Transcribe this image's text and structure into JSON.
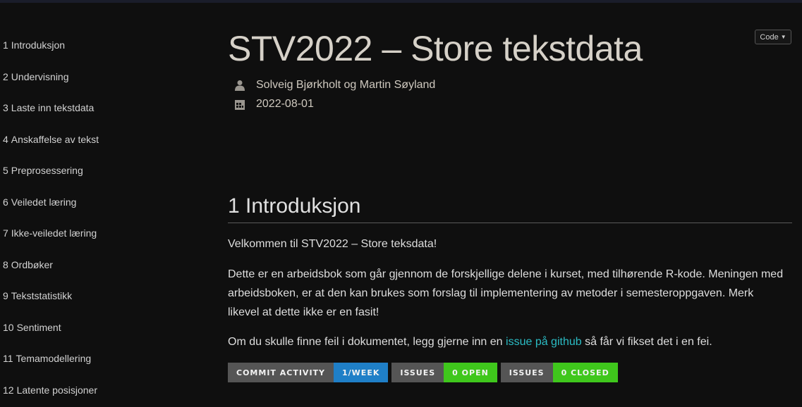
{
  "sidebar": {
    "items": [
      {
        "num": "1",
        "label": "Introduksjon"
      },
      {
        "num": "2",
        "label": "Undervisning"
      },
      {
        "num": "3",
        "label": "Laste inn tekstdata"
      },
      {
        "num": "4",
        "label": "Anskaffelse av tekst"
      },
      {
        "num": "5",
        "label": "Preprosessering"
      },
      {
        "num": "6",
        "label": "Veiledet læring"
      },
      {
        "num": "7",
        "label": "Ikke-veiledet læring"
      },
      {
        "num": "8",
        "label": "Ordbøker"
      },
      {
        "num": "9",
        "label": "Tekststatistikk"
      },
      {
        "num": "10",
        "label": "Sentiment"
      },
      {
        "num": "11",
        "label": "Temamodellering"
      },
      {
        "num": "12",
        "label": "Latente posisjoner"
      }
    ]
  },
  "header": {
    "title": "STV2022 – Store tekstdata",
    "author": "Solveig Bjørkholt og Martin Søyland",
    "date": "2022-08-01",
    "code_button": "Code"
  },
  "section": {
    "title": "1 Introduksjon",
    "p1": "Velkommen til STV2022 – Store teksdata!",
    "p2": "Dette er en arbeidsbok som går gjennom de forskjellige delene i kurset, med tilhørende R-kode. Meningen med arbeidsboken, er at den kan brukes som forslag til implementering av metoder i semesteroppgaven. Merk likevel at dette ikke er en fasit!",
    "p3_before": "Om du skulle finne feil i dokumentet, legg gjerne inn en",
    "p3_link": "issue på github",
    "p3_after": "så får vi fikset det i en fei."
  },
  "badges": [
    {
      "label": "COMMIT ACTIVITY",
      "value": "1/WEEK",
      "color": "#1f7fc7"
    },
    {
      "label": "ISSUES",
      "value": "0 OPEN",
      "color": "#3fc71c"
    },
    {
      "label": "ISSUES",
      "value": "0 CLOSED",
      "color": "#3fc71c"
    }
  ],
  "icons": {
    "author": "person-icon",
    "date": "calendar-icon",
    "code_caret": "caret-down-icon"
  }
}
